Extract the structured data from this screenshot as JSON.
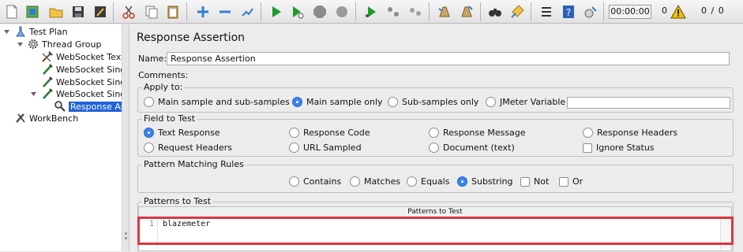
{
  "toolbar": {
    "icons": [
      "new-icon",
      "templates-icon",
      "open-icon",
      "save-icon",
      "save-as-icon",
      "cut-icon",
      "copy-icon",
      "paste-icon",
      "expand-icon",
      "collapse-icon",
      "toggle-icon",
      "start-icon",
      "start-no-pauses-icon",
      "stop-icon",
      "shutdown-icon",
      "remote-start-icon",
      "remote-stop-icon",
      "remote-shutdown-icon",
      "clear-icon",
      "clear-all-icon",
      "search-icon",
      "reset-search-icon",
      "function-helper-icon",
      "help-icon",
      "options-icon"
    ],
    "timer": "00:00:00",
    "error_count": "0",
    "threads": "0 / 0",
    "colors": {
      "green": "#1e9a2e",
      "red": "#c0392b",
      "warning": "#f2c200"
    }
  },
  "tree": {
    "items": [
      {
        "label": "Test Plan",
        "icon": "test-plan-icon"
      },
      {
        "label": "Thread Group",
        "icon": "thread-group-gear-icon"
      },
      {
        "label": "WebSocket Text F",
        "icon": "websocket-sampler-icon"
      },
      {
        "label": "WebSocket Single",
        "icon": "websocket-sampler-icon"
      },
      {
        "label": "WebSocket Single",
        "icon": "websocket-sampler-icon"
      },
      {
        "label": "WebSocket Single",
        "icon": "websocket-sampler-icon"
      },
      {
        "label": "Response Asse",
        "icon": "magnifier-icon"
      },
      {
        "label": "WorkBench",
        "icon": "workbench-icon"
      }
    ],
    "selected_color": "#1f63d6"
  },
  "panel": {
    "title": "Response Assertion",
    "name_label": "Name:",
    "name_value": "Response Assertion",
    "comments_label": "Comments:",
    "apply_to": {
      "title": "Apply to:",
      "options": [
        "Main sample and sub-samples",
        "Main sample only",
        "Sub-samples only",
        "JMeter Variable"
      ],
      "selected": "Main sample only"
    },
    "field_to_test": {
      "title": "Field to Test",
      "options": [
        "Text Response",
        "Response Code",
        "Response Message",
        "Response Headers",
        "Request Headers",
        "URL Sampled",
        "Document (text)"
      ],
      "selected": "Text Response",
      "checkbox": "Ignore Status"
    },
    "pattern_rules": {
      "title": "Pattern Matching Rules",
      "options": [
        "Contains",
        "Matches",
        "Equals",
        "Substring"
      ],
      "selected": "Substring",
      "checkboxes": [
        "Not",
        "Or"
      ]
    },
    "patterns": {
      "title": "Patterns to Test",
      "header": "Patterns to Test",
      "line_number": "1",
      "value": "blazemeter"
    }
  },
  "highlight_color": "#e0343c"
}
